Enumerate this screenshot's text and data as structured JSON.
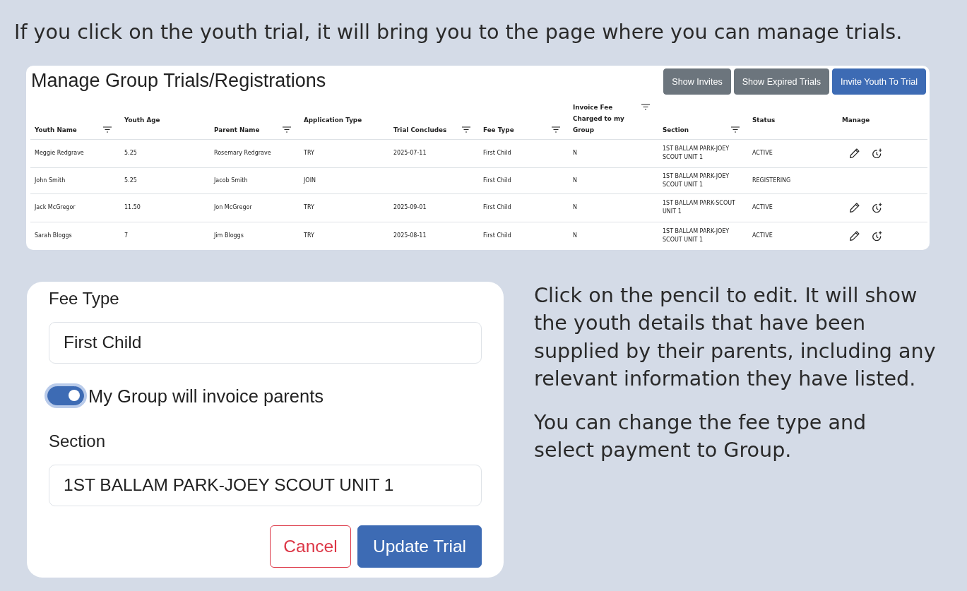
{
  "intro": "If you click on the youth trial, it will bring you to the page where you can manage trials.",
  "manage_panel": {
    "title": "Manage Group Trials/Registrations",
    "buttons": [
      {
        "label": "Show Invites",
        "kind": "secondary"
      },
      {
        "label": "Show Expired Trials",
        "kind": "secondary"
      },
      {
        "label": "Invite Youth To Trial",
        "kind": "primary"
      }
    ],
    "table": {
      "columns": [
        {
          "label": "Youth Name",
          "filter": true
        },
        {
          "label": "Youth Age",
          "filter": false
        },
        {
          "label": "Parent Name",
          "filter": true
        },
        {
          "label": "Application Type",
          "filter": false
        },
        {
          "label": "Trial Concludes",
          "filter": true
        },
        {
          "label": "Fee Type",
          "filter": true
        },
        {
          "label": "Invoice Fee Charged to my Group",
          "filter": true
        },
        {
          "label": "Section",
          "filter": true
        },
        {
          "label": "Status",
          "filter": false
        },
        {
          "label": "Manage",
          "filter": false
        }
      ],
      "rows": [
        {
          "youth_name": "Meggie Redgrave",
          "youth_age": "5.25",
          "parent_name": "Rosemary Redgrave",
          "application_type": "TRY",
          "trial_concludes": "2025-07-11",
          "fee_type": "First Child",
          "invoice_fee": "N",
          "section": "1ST BALLAM PARK-JOEY SCOUT UNIT 1",
          "status": "ACTIVE",
          "has_actions": true
        },
        {
          "youth_name": "John Smith",
          "youth_age": "5.25",
          "parent_name": "Jacob Smith",
          "application_type": "JOIN",
          "fee_type": "First Child",
          "invoice_fee": "N",
          "section": "1ST BALLAM PARK-JOEY SCOUT UNIT 1",
          "status": "REGISTERING",
          "has_actions": false
        },
        {
          "youth_name": "Jack McGregor",
          "youth_age": "11.50",
          "parent_name": "Jon McGregor",
          "application_type": "TRY",
          "trial_concludes": "2025-09-01",
          "fee_type": "First Child",
          "invoice_fee": "N",
          "section": "1ST BALLAM PARK-SCOUT UNIT 1",
          "status": "ACTIVE",
          "has_actions": true
        },
        {
          "youth_name": "Sarah Bloggs",
          "youth_age": "7",
          "parent_name": "Jim Bloggs",
          "application_type": "TRY",
          "trial_concludes": "2025-08-11",
          "fee_type": "First Child",
          "invoice_fee": "N",
          "section": "1ST BALLAM PARK-JOEY SCOUT UNIT 1",
          "status": "ACTIVE",
          "has_actions": true
        }
      ]
    }
  },
  "edit_form": {
    "fields": [
      {
        "kind": "input",
        "label": "Fee Type",
        "value": "First Child"
      },
      {
        "kind": "toggle",
        "label": "My Group will invoice parents",
        "on": true,
        "focused": true
      },
      {
        "kind": "input",
        "label": "Section",
        "value": "1ST BALLAM PARK-JOEY SCOUT UNIT 1"
      }
    ],
    "buttons": [
      {
        "label": "Cancel",
        "kind": "danger"
      },
      {
        "label": "Update Trial",
        "kind": "primary"
      }
    ]
  },
  "notes": [
    "Click on the pencil to edit. It will show the youth details that have been supplied by their parents, including any relevant information they have listed.",
    "You can change the fee type and select payment to Group."
  ]
}
